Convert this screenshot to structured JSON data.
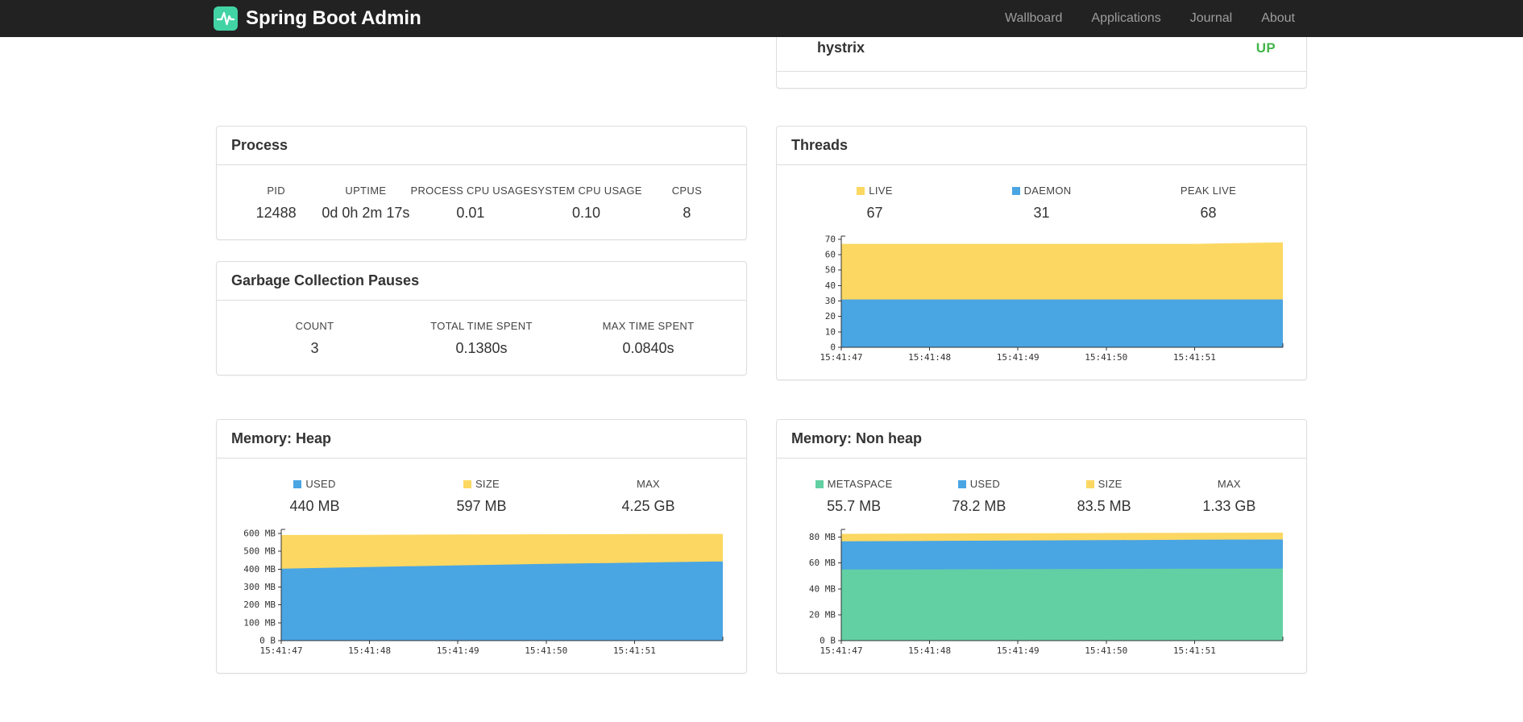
{
  "navbar": {
    "brand": "Spring Boot Admin",
    "items": [
      {
        "label": "Wallboard"
      },
      {
        "label": "Applications"
      },
      {
        "label": "Journal"
      },
      {
        "label": "About"
      }
    ]
  },
  "colors": {
    "navbar_bg": "#222222",
    "brand_green": "#42d3a5",
    "status_up": "#44b549",
    "chart_blue": "#4aa5e3",
    "chart_yellow": "#fcd862",
    "chart_green": "#63d0a4"
  },
  "applications_panel": {
    "rows": [
      {
        "name": "hystrix",
        "status": "UP"
      }
    ]
  },
  "process_panel": {
    "title": "Process",
    "metrics": [
      {
        "label": "PID",
        "value": "12488"
      },
      {
        "label": "UPTIME",
        "value": "0d 0h 2m 17s"
      },
      {
        "label": "PROCESS CPU USAGE",
        "value": "0.01"
      },
      {
        "label": "SYSTEM CPU USAGE",
        "value": "0.10"
      },
      {
        "label": "CPUS",
        "value": "8"
      }
    ]
  },
  "gc_panel": {
    "title": "Garbage Collection Pauses",
    "metrics": [
      {
        "label": "COUNT",
        "value": "3"
      },
      {
        "label": "TOTAL TIME SPENT",
        "value": "0.1380s"
      },
      {
        "label": "MAX TIME SPENT",
        "value": "0.0840s"
      }
    ]
  },
  "threads_panel": {
    "title": "Threads",
    "legend": [
      {
        "label": "LIVE",
        "value": "67",
        "color": "#fcd862"
      },
      {
        "label": "DAEMON",
        "value": "31",
        "color": "#4aa5e3"
      },
      {
        "label": "PEAK LIVE",
        "value": "68",
        "color": null
      }
    ]
  },
  "heap_panel": {
    "title": "Memory: Heap",
    "legend": [
      {
        "label": "USED",
        "value": "440 MB",
        "color": "#4aa5e3"
      },
      {
        "label": "SIZE",
        "value": "597 MB",
        "color": "#fcd862"
      },
      {
        "label": "MAX",
        "value": "4.25 GB",
        "color": null
      }
    ]
  },
  "nonheap_panel": {
    "title": "Memory: Non heap",
    "legend": [
      {
        "label": "METASPACE",
        "value": "55.7 MB",
        "color": "#63d0a4"
      },
      {
        "label": "USED",
        "value": "78.2 MB",
        "color": "#4aa5e3"
      },
      {
        "label": "SIZE",
        "value": "83.5 MB",
        "color": "#fcd862"
      },
      {
        "label": "MAX",
        "value": "1.33 GB",
        "color": null
      }
    ]
  },
  "chart_data": [
    {
      "id": "threads",
      "type": "area",
      "title": "Threads",
      "x_labels": [
        "15:41:47",
        "15:41:48",
        "15:41:49",
        "15:41:50",
        "15:41:51"
      ],
      "ylim": [
        0,
        72
      ],
      "yticks": [
        0,
        10,
        20,
        30,
        40,
        50,
        60,
        70
      ],
      "ytick_labels": [
        "0",
        "10",
        "20",
        "30",
        "40",
        "50",
        "60",
        "70"
      ],
      "grid": false,
      "series": [
        {
          "name": "LIVE",
          "color": "#fcd862",
          "values": [
            67,
            67,
            67,
            67,
            67,
            68
          ]
        },
        {
          "name": "DAEMON",
          "color": "#4aa5e3",
          "values": [
            31,
            31,
            31,
            31,
            31,
            31
          ]
        }
      ]
    },
    {
      "id": "heap",
      "type": "area",
      "title": "Memory: Heap",
      "x_labels": [
        "15:41:47",
        "15:41:48",
        "15:41:49",
        "15:41:50",
        "15:41:51"
      ],
      "ylim": [
        0,
        622
      ],
      "yticks": [
        0,
        100,
        200,
        300,
        400,
        500,
        600
      ],
      "ytick_labels": [
        "0 B",
        "100 MB",
        "200 MB",
        "300 MB",
        "400 MB",
        "500 MB",
        "600 MB"
      ],
      "grid": false,
      "series": [
        {
          "name": "SIZE",
          "color": "#fcd862",
          "values": [
            591,
            592,
            594,
            595,
            596,
            597
          ]
        },
        {
          "name": "USED",
          "color": "#4aa5e3",
          "values": [
            402,
            412,
            421,
            429,
            436,
            443
          ]
        }
      ]
    },
    {
      "id": "nonheap",
      "type": "area",
      "title": "Memory: Non heap",
      "x_labels": [
        "15:41:47",
        "15:41:48",
        "15:41:49",
        "15:41:50",
        "15:41:51"
      ],
      "ylim": [
        0,
        86
      ],
      "yticks": [
        0,
        20,
        40,
        60,
        80
      ],
      "ytick_labels": [
        "0 B",
        "20 MB",
        "40 MB",
        "60 MB",
        "80 MB"
      ],
      "grid": false,
      "series": [
        {
          "name": "SIZE",
          "color": "#fcd862",
          "values": [
            82.6,
            82.8,
            83.0,
            83.2,
            83.4,
            83.5
          ]
        },
        {
          "name": "USED",
          "color": "#4aa5e3",
          "values": [
            76.8,
            77.1,
            77.4,
            77.7,
            78.0,
            78.2
          ]
        },
        {
          "name": "METASPACE",
          "color": "#63d0a4",
          "values": [
            55.0,
            55.1,
            55.3,
            55.4,
            55.6,
            55.7
          ]
        }
      ]
    }
  ]
}
